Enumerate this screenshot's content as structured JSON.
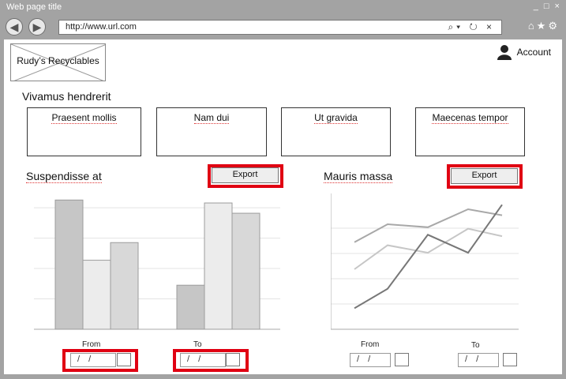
{
  "window": {
    "title": "Web page title",
    "controls": "_ □ ×"
  },
  "browser": {
    "url": "http://www.url.com",
    "url_icons": "⌕▾ ↻ ×",
    "toolbar_icons": "⌂★⚙"
  },
  "header": {
    "logo_text": "Rudy’s Recyclables",
    "account_label": "Account"
  },
  "section": {
    "title": "Vivamus hendrerit"
  },
  "cards": [
    {
      "label": "Praesent mollis"
    },
    {
      "label": "Nam dui"
    },
    {
      "label": "Ut gravida"
    },
    {
      "label": "Maecenas tempor"
    }
  ],
  "left_panel": {
    "title": "Suspendisse at",
    "export_label": "Export",
    "from_label": "From",
    "to_label": "To",
    "from_value": "/ /",
    "to_value": "/ /"
  },
  "right_panel": {
    "title": "Mauris massa",
    "export_label": "Export",
    "from_label": "From",
    "to_label": "To",
    "from_value": "/ /",
    "to_value": "/ /"
  },
  "chart_data": [
    {
      "type": "bar",
      "categories": [
        "",
        ""
      ],
      "series": [
        {
          "values": [
            88,
            30
          ],
          "color": "#c6c6c6"
        },
        {
          "values": [
            47,
            86
          ],
          "color": "#ececec"
        },
        {
          "values": [
            59,
            79
          ],
          "color": "#d8d8d8"
        }
      ],
      "ylim": [
        0,
        100
      ],
      "grid": true
    },
    {
      "type": "line",
      "x": [
        0,
        1,
        2,
        3,
        4
      ],
      "series": [
        {
          "values": [
            58,
            70,
            68,
            80,
            76
          ],
          "color": "#a8a8a8"
        },
        {
          "values": [
            40,
            56,
            51,
            67,
            62
          ],
          "color": "#c6c6c6"
        },
        {
          "values": [
            14,
            27,
            63,
            51,
            83
          ],
          "color": "#777777"
        }
      ],
      "ylim": [
        0,
        100
      ],
      "grid": true
    }
  ]
}
